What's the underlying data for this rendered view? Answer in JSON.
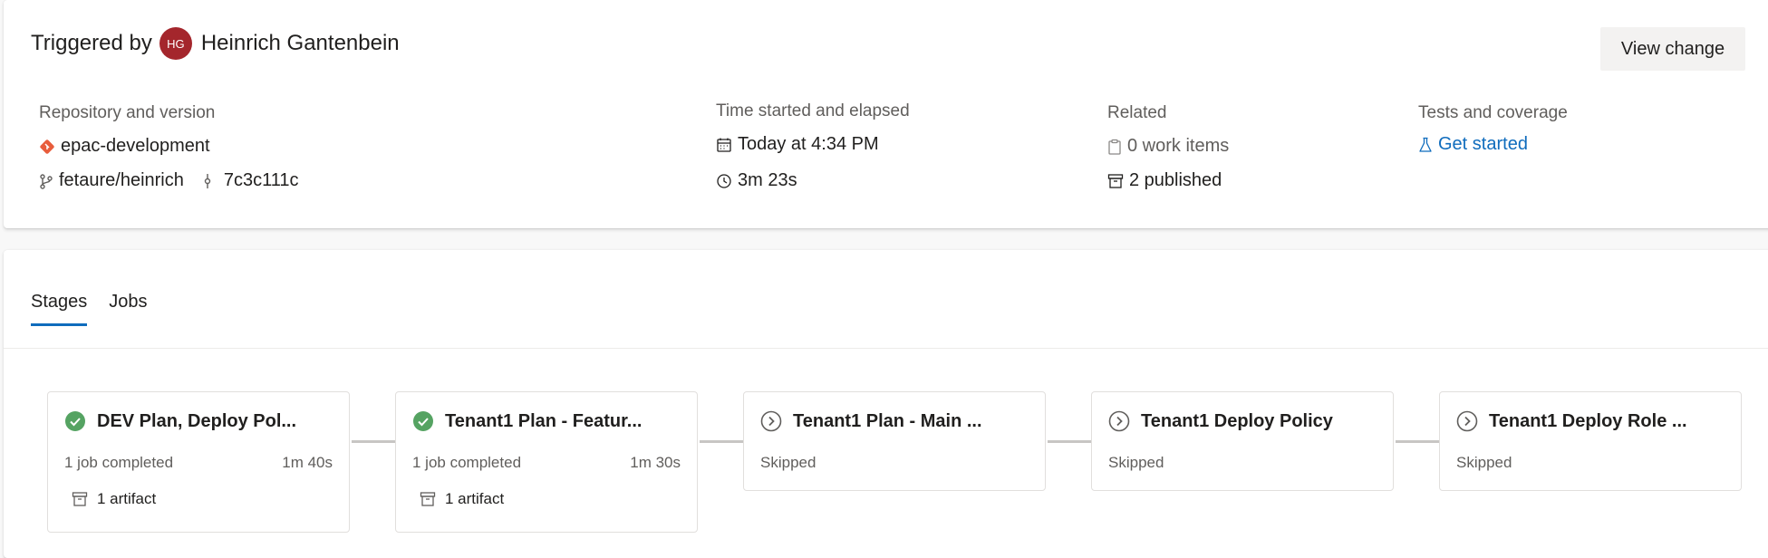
{
  "summary": {
    "triggered_label": "Triggered by",
    "user_initials": "HG",
    "user_name": "Heinrich Gantenbein",
    "view_change": "View change",
    "repo_section_label": "Repository and version",
    "repo_name": "epac-development",
    "branch": "fetaure/heinrich",
    "commit": "7c3c111c",
    "time_section_label": "Time started and elapsed",
    "started": "Today at 4:34 PM",
    "elapsed": "3m 23s",
    "related_section_label": "Related",
    "work_items": "0 work items",
    "published": "2 published",
    "tests_section_label": "Tests and coverage",
    "get_started": "Get started"
  },
  "tabs": [
    {
      "label": "Stages",
      "active": true
    },
    {
      "label": "Jobs",
      "active": false
    }
  ],
  "stages": [
    {
      "title": "DEV Plan, Deploy Pol...",
      "status": "success",
      "sub": "1 job completed",
      "duration": "1m 40s",
      "artifact": "1 artifact"
    },
    {
      "title": "Tenant1 Plan - Featur...",
      "status": "success",
      "sub": "1 job completed",
      "duration": "1m 30s",
      "artifact": "1 artifact"
    },
    {
      "title": "Tenant1 Plan - Main ...",
      "status": "skipped",
      "sub": "Skipped"
    },
    {
      "title": "Tenant1 Deploy Policy",
      "status": "skipped",
      "sub": "Skipped"
    },
    {
      "title": "Tenant1 Deploy Role ...",
      "status": "skipped",
      "sub": "Skipped"
    }
  ],
  "colors": {
    "success": "#55a362",
    "accent": "#0f6cbd",
    "avatar": "#a4262c",
    "git": "#e85d3c"
  }
}
